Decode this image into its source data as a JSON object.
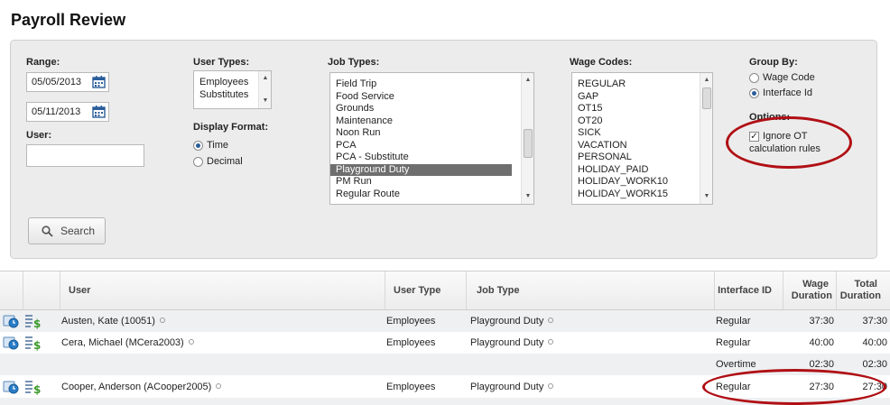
{
  "page": {
    "title": "Payroll Review"
  },
  "filters": {
    "range_label": "Range:",
    "start_date": "05/05/2013",
    "end_date": "05/11/2013",
    "user_label": "User:",
    "user_value": "",
    "user_types_label": "User Types:",
    "user_types": [
      "Employees",
      "Substitutes"
    ],
    "display_format_label": "Display Format:",
    "display_formats": [
      {
        "label": "Time",
        "selected": true
      },
      {
        "label": "Decimal",
        "selected": false
      }
    ],
    "job_types_label": "Job Types:",
    "job_types": [
      "Field Trip",
      "Food Service",
      "Grounds",
      "Maintenance",
      "Noon Run",
      "PCA",
      "PCA - Substitute",
      "Playground Duty",
      "PM Run",
      "Regular Route"
    ],
    "job_types_selected": "Playground Duty",
    "wage_codes_label": "Wage Codes:",
    "wage_codes": [
      "REGULAR",
      "GAP",
      "OT15",
      "OT20",
      "SICK",
      "VACATION",
      "PERSONAL",
      "HOLIDAY_PAID",
      "HOLIDAY_WORK10",
      "HOLIDAY_WORK15"
    ],
    "group_by_label": "Group By:",
    "group_by": [
      {
        "label": "Wage Code",
        "selected": false
      },
      {
        "label": "Interface Id",
        "selected": true
      }
    ],
    "options_label": "Options:",
    "ignore_ot_label_1": "Ignore OT",
    "ignore_ot_label_2": "calculation rules",
    "ignore_ot_checked": true,
    "search_label": "Search"
  },
  "table": {
    "headers": {
      "user": "User",
      "user_type": "User Type",
      "job_type": "Job Type",
      "interface_id": "Interface ID",
      "wage_duration_1": "Wage",
      "wage_duration_2": "Duration",
      "total_duration_1": "Total",
      "total_duration_2": "Duration"
    },
    "rows": [
      {
        "user": "Austen, Kate (10051)",
        "user_type": "Employees",
        "job_type": "Playground Duty",
        "interface_id": "Regular",
        "wage_duration": "37:30",
        "total_duration": "37:30"
      },
      {
        "user": "Cera, Michael (MCera2003)",
        "user_type": "Employees",
        "job_type": "Playground Duty",
        "interface_id": "Regular",
        "wage_duration": "40:00",
        "total_duration": "40:00"
      },
      {
        "user": "",
        "user_type": "",
        "job_type": "",
        "interface_id": "Overtime",
        "wage_duration": "02:30",
        "total_duration": "02:30"
      },
      {
        "user": "Cooper, Anderson (ACooper2005)",
        "user_type": "Employees",
        "job_type": "Playground Duty",
        "interface_id": "Regular",
        "wage_duration": "27:30",
        "total_duration": "27:30"
      }
    ]
  },
  "colors": {
    "annotation": "#b00f14",
    "selected_item": "#6e6e6e",
    "radio_dot": "#2a5d9a"
  },
  "icons": [
    "calendar-icon",
    "search-icon",
    "clock-icon",
    "pay-stub-icon",
    "info-dot-icon"
  ]
}
